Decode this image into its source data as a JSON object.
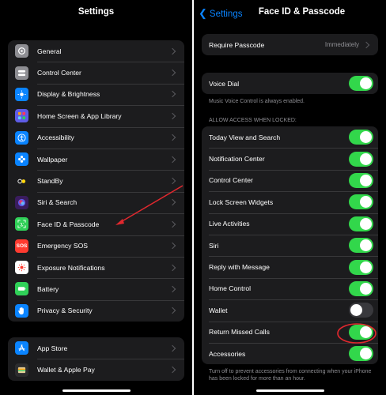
{
  "left": {
    "title": "Settings",
    "group1": [
      {
        "label": "General",
        "icon": "gear-icon",
        "color": "#8e8e93"
      },
      {
        "label": "Control Center",
        "icon": "toggles-icon",
        "color": "#8e8e93"
      },
      {
        "label": "Display & Brightness",
        "icon": "sun-icon",
        "color": "#0a84ff"
      },
      {
        "label": "Home Screen & App Library",
        "icon": "app-grid-icon",
        "color": "#5e5ce6"
      },
      {
        "label": "Accessibility",
        "icon": "accessibility-icon",
        "color": "#0a84ff"
      },
      {
        "label": "Wallpaper",
        "icon": "flower-icon",
        "color": "#0a84ff"
      },
      {
        "label": "StandBy",
        "icon": "standby-icon",
        "color": "#1c1c1e"
      },
      {
        "label": "Siri & Search",
        "icon": "siri-icon",
        "color": "#3a1c5e"
      },
      {
        "label": "Face ID & Passcode",
        "icon": "face-id-icon",
        "color": "#30d158"
      },
      {
        "label": "Emergency SOS",
        "icon": "sos-icon",
        "color": "#ff3b30",
        "text": "SOS"
      },
      {
        "label": "Exposure Notifications",
        "icon": "exposure-icon",
        "color": "#ffffff"
      },
      {
        "label": "Battery",
        "icon": "battery-icon",
        "color": "#30d158"
      },
      {
        "label": "Privacy & Security",
        "icon": "hand-icon",
        "color": "#0a84ff"
      }
    ],
    "group2": [
      {
        "label": "App Store",
        "icon": "app-store-icon",
        "color": "#0a84ff"
      },
      {
        "label": "Wallet & Apple Pay",
        "icon": "wallet-icon",
        "color": "#2c2c2e"
      }
    ]
  },
  "right": {
    "back_label": "Settings",
    "title": "Face ID & Passcode",
    "require_passcode": {
      "label": "Require Passcode",
      "value": "Immediately"
    },
    "voice_dial": {
      "label": "Voice Dial",
      "on": true
    },
    "voice_dial_caption": "Music Voice Control is always enabled.",
    "section_header": "ALLOW ACCESS WHEN LOCKED:",
    "locked_items": [
      {
        "label": "Today View and Search",
        "on": true
      },
      {
        "label": "Notification Center",
        "on": true
      },
      {
        "label": "Control Center",
        "on": true
      },
      {
        "label": "Lock Screen Widgets",
        "on": true
      },
      {
        "label": "Live Activities",
        "on": true
      },
      {
        "label": "Siri",
        "on": true
      },
      {
        "label": "Reply with Message",
        "on": true
      },
      {
        "label": "Home Control",
        "on": true
      },
      {
        "label": "Wallet",
        "on": false
      },
      {
        "label": "Return Missed Calls",
        "on": true
      },
      {
        "label": "Accessories",
        "on": true
      }
    ],
    "accessories_caption": "Turn off to prevent accessories from connecting when your iPhone has been locked for more than an hour."
  },
  "annotation_colors": {
    "arrow": "#e0282e",
    "circle": "#e0282e"
  },
  "toggle_on_color": "#32d74b"
}
